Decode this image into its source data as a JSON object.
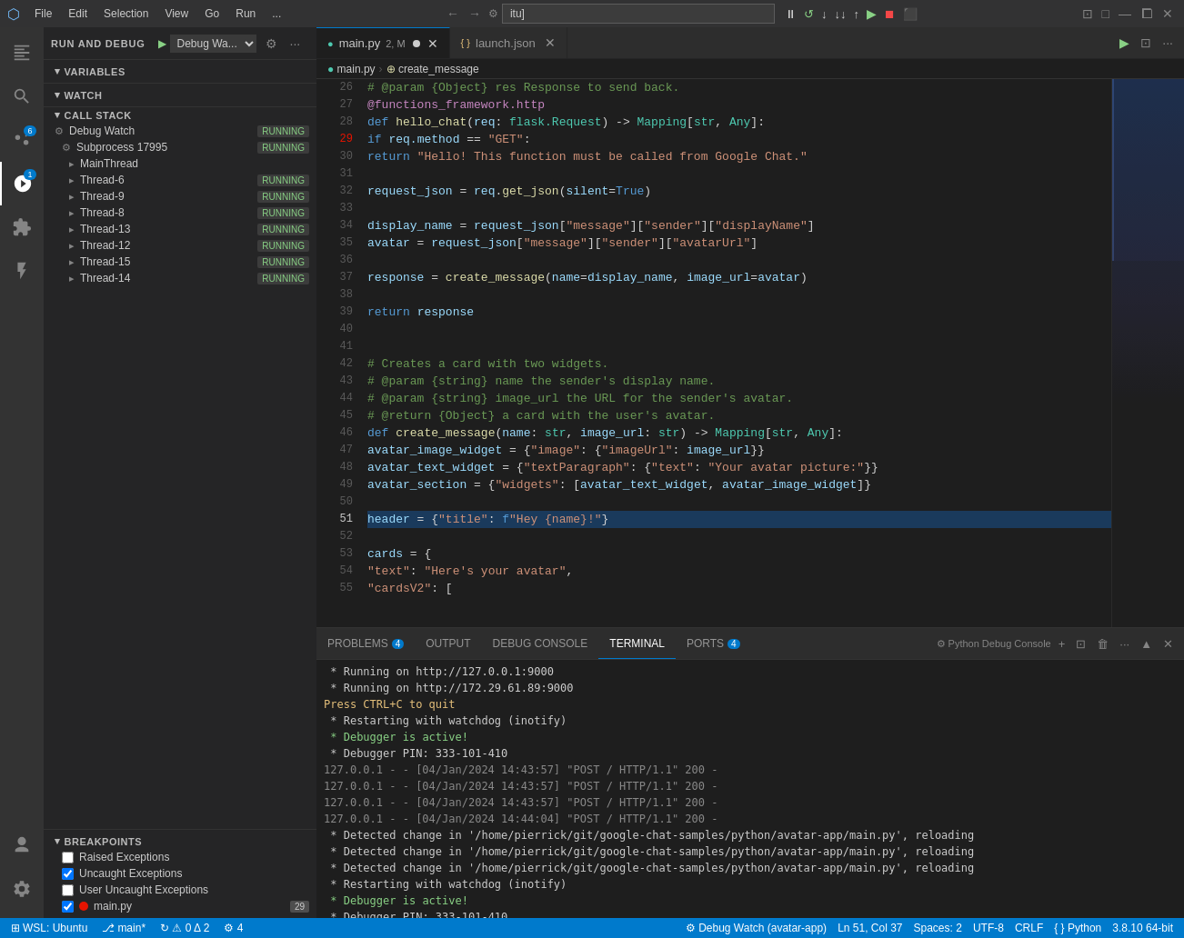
{
  "titlebar": {
    "icon": "⬡",
    "menus": [
      "File",
      "Edit",
      "Selection",
      "View",
      "Go",
      "Run",
      "..."
    ],
    "nav_back": "←",
    "nav_forward": "→",
    "search_value": "itu]",
    "debug_controls": [
      "⏸",
      "↺",
      "↓",
      "↑",
      "⬇",
      "⬆",
      "⏹",
      "⬛"
    ],
    "window_controls": [
      "🗖",
      "🗗",
      "⊡",
      "□",
      "—",
      "⧠",
      "✕"
    ]
  },
  "tabs": [
    {
      "id": "main_py",
      "label": "main.py",
      "tag": "2, M",
      "modified": true,
      "active": true,
      "icon": "●"
    },
    {
      "id": "launch_json",
      "label": "launch.json",
      "modified": false,
      "active": false,
      "icon": ""
    }
  ],
  "breadcrumb": [
    "main.py",
    ">",
    "create_message"
  ],
  "sidebar": {
    "title": "RUN AND DEBUG",
    "debug_config": "Debug Wa...",
    "sections": {
      "variables": "VARIABLES",
      "watch": "WATCH",
      "callstack": "CALL STACK",
      "breakpoints": "BREAKPOINTS"
    },
    "callstack_items": [
      {
        "name": "Debug Watch",
        "status": "RUNNING",
        "level": 1
      },
      {
        "name": "Subprocess 17995",
        "status": "RUNNING",
        "level": 2
      },
      {
        "name": "MainThread",
        "status": "",
        "level": 3
      },
      {
        "name": "Thread-6",
        "status": "RUNNING",
        "level": 3
      },
      {
        "name": "Thread-9",
        "status": "RUNNING",
        "level": 3
      },
      {
        "name": "Thread-8",
        "status": "RUNNING",
        "level": 3
      },
      {
        "name": "Thread-13",
        "status": "RUNNING",
        "level": 3
      },
      {
        "name": "Thread-12",
        "status": "RUNNING",
        "level": 3
      },
      {
        "name": "Thread-15",
        "status": "RUNNING",
        "level": 3
      },
      {
        "name": "Thread-14",
        "status": "RUNNING",
        "level": 3
      }
    ],
    "breakpoints": [
      {
        "label": "Raised Exceptions",
        "checked": false,
        "type": "checkbox"
      },
      {
        "label": "Uncaught Exceptions",
        "checked": true,
        "type": "checkbox"
      },
      {
        "label": "User Uncaught Exceptions",
        "checked": false,
        "type": "checkbox"
      },
      {
        "label": "main.py",
        "checked": true,
        "type": "file",
        "count": "29",
        "dot": true
      }
    ]
  },
  "code": {
    "lines": [
      {
        "num": 26,
        "content": "    # @param {Object} res Response to send back."
      },
      {
        "num": 27,
        "content": "    @functions_framework.http"
      },
      {
        "num": 28,
        "content": "    def hello_chat(req: flask.Request) -> Mapping[str, Any]:"
      },
      {
        "num": 29,
        "content": "        if req.method == \"GET\":",
        "breakpoint": true
      },
      {
        "num": 30,
        "content": "            return \"Hello! This function must be called from Google Chat.\""
      },
      {
        "num": 31,
        "content": ""
      },
      {
        "num": 32,
        "content": "        request_json = req.get_json(silent=True)"
      },
      {
        "num": 33,
        "content": ""
      },
      {
        "num": 34,
        "content": "        display_name = request_json[\"message\"][\"sender\"][\"displayName\"]"
      },
      {
        "num": 35,
        "content": "        avatar = request_json[\"message\"][\"sender\"][\"avatarUrl\"]"
      },
      {
        "num": 36,
        "content": ""
      },
      {
        "num": 37,
        "content": "        response = create_message(name=display_name, image_url=avatar)"
      },
      {
        "num": 38,
        "content": ""
      },
      {
        "num": 39,
        "content": "        return response"
      },
      {
        "num": 40,
        "content": ""
      },
      {
        "num": 41,
        "content": ""
      },
      {
        "num": 42,
        "content": "    # Creates a card with two widgets."
      },
      {
        "num": 43,
        "content": "    # @param {string} name the sender's display name."
      },
      {
        "num": 44,
        "content": "    # @param {string} image_url the URL for the sender's avatar."
      },
      {
        "num": 45,
        "content": "    # @return {Object} a card with the user's avatar."
      },
      {
        "num": 46,
        "content": "    def create_message(name: str, image_url: str) -> Mapping[str, Any]:"
      },
      {
        "num": 47,
        "content": "        avatar_image_widget = {\"image\": {\"imageUrl\": image_url}}"
      },
      {
        "num": 48,
        "content": "        avatar_text_widget = {\"textParagraph\": {\"text\": \"Your avatar picture:\"}}"
      },
      {
        "num": 49,
        "content": "        avatar_section = {\"widgets\": [avatar_text_widget, avatar_image_widget]}"
      },
      {
        "num": 50,
        "content": ""
      },
      {
        "num": 51,
        "content": "        header = {\"title\": f\"Hey {name}!\"}",
        "current": true
      },
      {
        "num": 52,
        "content": ""
      },
      {
        "num": 53,
        "content": "        cards = {"
      },
      {
        "num": 54,
        "content": "            \"text\": \"Here's your avatar\","
      },
      {
        "num": 55,
        "content": "            \"cardsV2\": ["
      }
    ]
  },
  "panel": {
    "tabs": [
      {
        "id": "problems",
        "label": "PROBLEMS",
        "badge": "4"
      },
      {
        "id": "output",
        "label": "OUTPUT"
      },
      {
        "id": "debug_console",
        "label": "DEBUG CONSOLE"
      },
      {
        "id": "terminal",
        "label": "TERMINAL",
        "active": true
      },
      {
        "id": "ports",
        "label": "PORTS",
        "badge": "4"
      }
    ],
    "terminal_title": "Python Debug Console",
    "terminal_lines": [
      {
        "type": "normal",
        "text": " * Running on http://127.0.0.1:9000"
      },
      {
        "type": "normal",
        "text": " * Running on http://172.29.61.89:9000"
      },
      {
        "type": "yellow",
        "text": "Press CTRL+C to quit"
      },
      {
        "type": "normal",
        "text": " * Restarting with watchdog (inotify)"
      },
      {
        "type": "green",
        "text": " * Debugger is active!"
      },
      {
        "type": "normal",
        "text": " * Debugger PIN: 333-101-410"
      },
      {
        "type": "dim",
        "text": "127.0.0.1 - - [04/Jan/2024 14:43:57] \"POST / HTTP/1.1\" 200 -"
      },
      {
        "type": "dim",
        "text": "127.0.0.1 - - [04/Jan/2024 14:43:57] \"POST / HTTP/1.1\" 200 -"
      },
      {
        "type": "dim",
        "text": "127.0.0.1 - - [04/Jan/2024 14:43:57] \"POST / HTTP/1.1\" 200 -"
      },
      {
        "type": "dim",
        "text": "127.0.0.1 - - [04/Jan/2024 14:44:04] \"POST / HTTP/1.1\" 200 -"
      },
      {
        "type": "normal",
        "text": " * Detected change in '/home/pierrick/git/google-chat-samples/python/avatar-app/main.py', reloading"
      },
      {
        "type": "normal",
        "text": " * Detected change in '/home/pierrick/git/google-chat-samples/python/avatar-app/main.py', reloading"
      },
      {
        "type": "normal",
        "text": " * Detected change in '/home/pierrick/git/google-chat-samples/python/avatar-app/main.py', reloading"
      },
      {
        "type": "normal",
        "text": " * Restarting with watchdog (inotify)"
      },
      {
        "type": "green",
        "text": " * Debugger is active!"
      },
      {
        "type": "normal",
        "text": " * Debugger PIN: 333-101-410"
      }
    ]
  },
  "statusbar": {
    "left": [
      {
        "id": "wsl",
        "text": "⊞ WSL: Ubuntu"
      },
      {
        "id": "branch",
        "text": "⎇ main*"
      },
      {
        "id": "sync",
        "text": "↻ ⚠ 0 Δ 2"
      },
      {
        "id": "debug",
        "text": "⚙ 4"
      }
    ],
    "right": [
      {
        "id": "debug_watch",
        "text": "⚙ Debug Watch (avatar-app)"
      },
      {
        "id": "line_col",
        "text": "Ln 51, Col 37"
      },
      {
        "id": "spaces",
        "text": "Spaces: 2"
      },
      {
        "id": "encoding",
        "text": "UTF-8"
      },
      {
        "id": "line_ending",
        "text": "CRLF"
      },
      {
        "id": "language",
        "text": "{ } Python"
      },
      {
        "id": "python_version",
        "text": "3.8.10 64-bit"
      }
    ]
  }
}
